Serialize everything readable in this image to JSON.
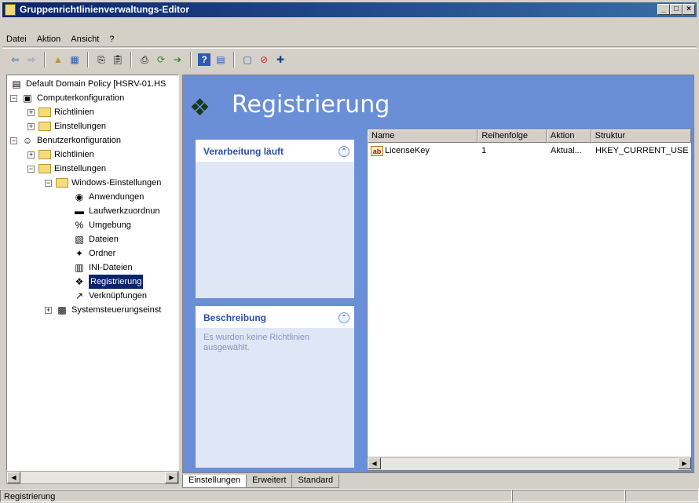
{
  "window": {
    "title": "Gruppenrichtlinienverwaltungs-Editor"
  },
  "menu": [
    "Datei",
    "Aktion",
    "Ansicht",
    "?"
  ],
  "toolbar_icons": [
    "back-arrow-icon",
    "forward-arrow-icon",
    "up-folder-icon",
    "show-hide-tree-icon",
    "copy-icon",
    "paste-icon",
    "print-icon",
    "refresh-icon",
    "export-list-icon",
    "help-icon",
    "properties-icon",
    "new-item-icon",
    "stop-icon",
    "add-icon"
  ],
  "tree": {
    "items": [
      {
        "label": "Default Domain Policy [HSRV-01.HS",
        "level": 0,
        "expander": "",
        "icon": "policy-icon"
      },
      {
        "label": "Computerkonfiguration",
        "level": 0,
        "expander": "−",
        "icon": "computer-icon"
      },
      {
        "label": "Richtlinien",
        "level": 1,
        "expander": "+",
        "icon": "folder-icon"
      },
      {
        "label": "Einstellungen",
        "level": 1,
        "expander": "+",
        "icon": "folder-icon"
      },
      {
        "label": "Benutzerkonfiguration",
        "level": 0,
        "expander": "−",
        "icon": "users-icon"
      },
      {
        "label": "Richtlinien",
        "level": 1,
        "expander": "+",
        "icon": "folder-icon"
      },
      {
        "label": "Einstellungen",
        "level": 1,
        "expander": "−",
        "icon": "folder-icon"
      },
      {
        "label": "Windows-Einstellungen",
        "level": 2,
        "expander": "−",
        "icon": "folder-icon"
      },
      {
        "label": "Anwendungen",
        "level": 3,
        "expander": "",
        "icon": "applications-icon"
      },
      {
        "label": "Laufwerkzuordnun",
        "level": 3,
        "expander": "",
        "icon": "drive-map-icon"
      },
      {
        "label": "Umgebung",
        "level": 3,
        "expander": "",
        "icon": "environment-icon"
      },
      {
        "label": "Dateien",
        "level": 3,
        "expander": "",
        "icon": "files-icon"
      },
      {
        "label": "Ordner",
        "level": 3,
        "expander": "",
        "icon": "folder-star-icon"
      },
      {
        "label": "INI-Dateien",
        "level": 3,
        "expander": "",
        "icon": "ini-file-icon"
      },
      {
        "label": "Registrierung",
        "level": 3,
        "expander": "",
        "icon": "registry-icon",
        "selected": true
      },
      {
        "label": "Verknüpfungen",
        "level": 3,
        "expander": "",
        "icon": "shortcut-icon"
      },
      {
        "label": "Systemsteuerungseinst",
        "level": 2,
        "expander": "+",
        "icon": "control-panel-folder-icon"
      }
    ]
  },
  "main": {
    "title": "Registrierung",
    "processing_panel": {
      "title": "Verarbeitung läuft",
      "body": ""
    },
    "description_panel": {
      "title": "Beschreibung",
      "body": "Es wurden keine Richtlinien ausgewählt."
    },
    "columns": [
      "Name",
      "Reihenfolge",
      "Aktion",
      "Struktur"
    ],
    "rows": [
      {
        "name": "LicenseKey",
        "order": "1",
        "action": "Aktual...",
        "hive": "HKEY_CURRENT_USE"
      }
    ]
  },
  "tabs": [
    "Einstellungen",
    "Erweitert",
    "Standard"
  ],
  "status": {
    "text": "Registrierung"
  },
  "colors": {
    "titlebar": "#0a246a",
    "panel_bg": "#6b8fd6",
    "selection": "#0a246a"
  }
}
